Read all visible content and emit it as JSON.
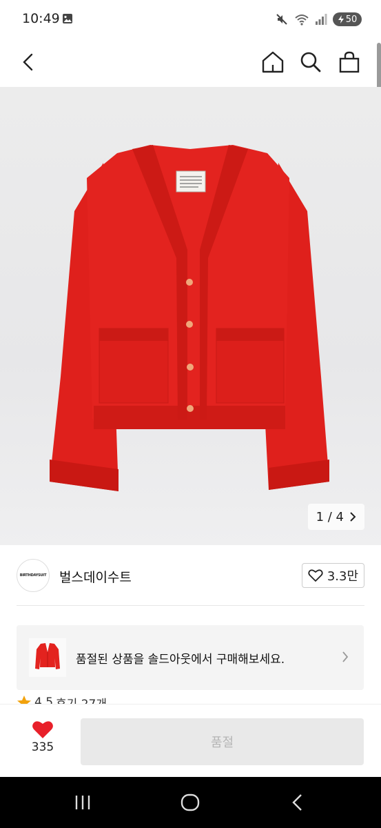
{
  "status_bar": {
    "time": "10:49",
    "battery": "50"
  },
  "product": {
    "image_counter": "1 / 4"
  },
  "brand": {
    "logo_text": "BIRTHDAYSUIT",
    "name": "벌스데이수트",
    "follow_count": "3.3만"
  },
  "soldout_banner": {
    "text": "품절된 상품을 솔드아웃에서 구매해보세요."
  },
  "rating": {
    "score": "4.5",
    "reviews": "후기 27개"
  },
  "bottom_bar": {
    "like_count": "335",
    "buy_label": "품절"
  },
  "colors": {
    "accent_heart": "#e8202a",
    "cardigan_red": "#e3231f"
  }
}
